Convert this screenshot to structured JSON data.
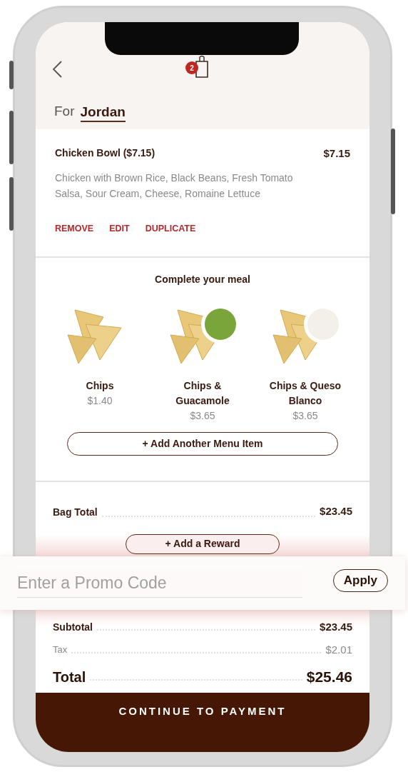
{
  "header": {
    "bag_count": "2"
  },
  "recipient": {
    "label": "For",
    "name": "Jordan"
  },
  "order_items": [
    {
      "name": "Chicken Bowl ($7.15)",
      "price": "$7.15",
      "description": "Chicken with Brown Rice, Black Beans, Fresh Tomato Salsa, Sour Cream, Cheese, Romaine Lettuce",
      "actions": [
        "REMOVE",
        "EDIT",
        "DUPLICATE"
      ]
    }
  ],
  "upsell": {
    "title": "Complete your meal",
    "items": [
      {
        "name": "Chips",
        "price": "$1.40"
      },
      {
        "name": "Chips & Guacamole",
        "price": "$3.65"
      },
      {
        "name": "Chips & Queso Blanco",
        "price": "$3.65"
      }
    ],
    "add_button": "+ Add Another Menu Item"
  },
  "bag_total": {
    "label": "Bag Total",
    "value": "$23.45"
  },
  "reward_button": "+ Add a Reward",
  "promo": {
    "placeholder": "Enter a Promo Code",
    "apply": "Apply"
  },
  "totals": [
    {
      "kind": "normal",
      "label": "Subtotal",
      "value": "$23.45"
    },
    {
      "kind": "muted",
      "label": "Tax",
      "value": "$2.01"
    },
    {
      "kind": "grand",
      "label": "Total",
      "value": "$25.46"
    }
  ],
  "continue_button": "CONTINUE TO PAYMENT"
}
